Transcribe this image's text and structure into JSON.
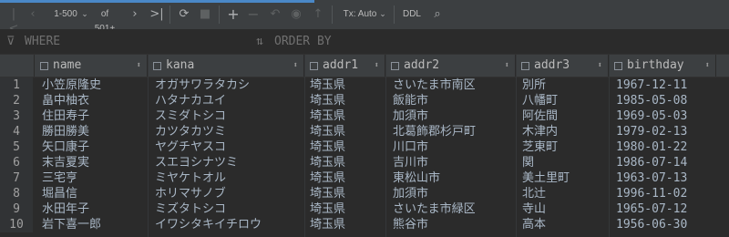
{
  "toolbar": {
    "range": "1-500",
    "of_total": "of 501+",
    "tx": "Tx: Auto",
    "ddl": "DDL"
  },
  "filter": {
    "where": "WHERE",
    "order_by": "ORDER BY"
  },
  "columns": [
    "name",
    "kana",
    "addr1",
    "addr2",
    "addr3",
    "birthday"
  ],
  "rows": [
    {
      "n": "1",
      "name": "小笠原隆史",
      "kana": "オガサワラタカシ",
      "addr1": "埼玉県",
      "addr2": "さいたま市南区",
      "addr3": "別所",
      "birthday": "1967-12-11"
    },
    {
      "n": "2",
      "name": "畠中柚衣",
      "kana": "ハタナカユイ",
      "addr1": "埼玉県",
      "addr2": "飯能市",
      "addr3": "八幡町",
      "birthday": "1985-05-08"
    },
    {
      "n": "3",
      "name": "住田寿子",
      "kana": "スミダトシコ",
      "addr1": "埼玉県",
      "addr2": "加須市",
      "addr3": "阿佐間",
      "birthday": "1969-05-03"
    },
    {
      "n": "4",
      "name": "勝田勝美",
      "kana": "カツタカツミ",
      "addr1": "埼玉県",
      "addr2": "北葛飾郡杉戸町",
      "addr3": "木津内",
      "birthday": "1979-02-13"
    },
    {
      "n": "5",
      "name": "矢口康子",
      "kana": "ヤグチヤスコ",
      "addr1": "埼玉県",
      "addr2": "川口市",
      "addr3": "芝東町",
      "birthday": "1980-01-22"
    },
    {
      "n": "6",
      "name": "末吉夏実",
      "kana": "スエヨシナツミ",
      "addr1": "埼玉県",
      "addr2": "吉川市",
      "addr3": "関",
      "birthday": "1986-07-14"
    },
    {
      "n": "7",
      "name": "三宅亨",
      "kana": "ミヤケトオル",
      "addr1": "埼玉県",
      "addr2": "東松山市",
      "addr3": "美土里町",
      "birthday": "1963-07-13"
    },
    {
      "n": "8",
      "name": "堀昌信",
      "kana": "ホリマサノブ",
      "addr1": "埼玉県",
      "addr2": "加須市",
      "addr3": "北辻",
      "birthday": "1996-11-02"
    },
    {
      "n": "9",
      "name": "水田年子",
      "kana": "ミズタトシコ",
      "addr1": "埼玉県",
      "addr2": "さいたま市緑区",
      "addr3": "寺山",
      "birthday": "1965-07-12"
    },
    {
      "n": "10",
      "name": "岩下喜一郎",
      "kana": "イワシタキイチロウ",
      "addr1": "埼玉県",
      "addr2": "熊谷市",
      "addr3": "高本",
      "birthday": "1956-06-30"
    }
  ]
}
